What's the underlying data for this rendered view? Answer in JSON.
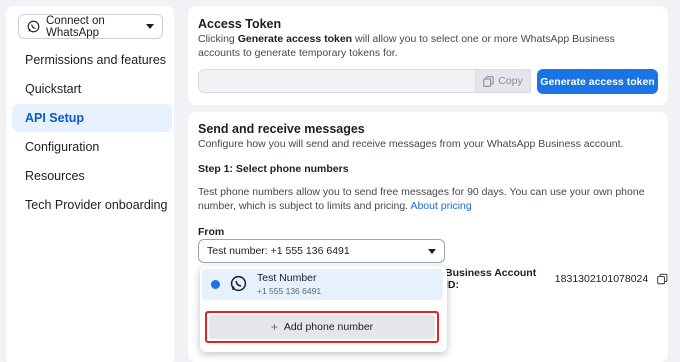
{
  "sidebar": {
    "whatsapp_select_label": "Connect on WhatsApp",
    "items": [
      {
        "label": "Permissions and features"
      },
      {
        "label": "Quickstart"
      },
      {
        "label": "API Setup",
        "active": true
      },
      {
        "label": "Configuration"
      },
      {
        "label": "Resources"
      },
      {
        "label": "Tech Provider onboarding"
      }
    ]
  },
  "access_token": {
    "title": "Access Token",
    "desc_prefix": "Clicking ",
    "desc_bold": "Generate access token",
    "desc_suffix": " will allow you to select one or more WhatsApp Business accounts to generate temporary tokens for.",
    "copy_label": "Copy",
    "generate_label": "Generate access token"
  },
  "send_receive": {
    "title": "Send and receive messages",
    "desc": "Configure how you will send and receive messages from your WhatsApp Business account.",
    "step1": "Step 1: Select phone numbers",
    "info": "Test phone numbers allow you to send free messages for 90 days. You can use your own phone number, which is subject to limits and pricing.",
    "about_pricing_link": "About pricing",
    "from_label": "From",
    "from_value": "Test number: +1 555 136 6491",
    "account_id_label": "Business Account ID:",
    "account_id_value": "1831302101078024",
    "dropdown": {
      "option_name": "Test Number",
      "option_number": "+1 555 136 6491",
      "add_label": "Add phone number"
    }
  },
  "colors": {
    "primary": "#1b74e4",
    "active_bg": "#e7f0fd",
    "highlight_border": "#e02424"
  },
  "icons": [
    "whatsapp-icon",
    "caret-down-icon",
    "copy-icon",
    "plus-icon"
  ]
}
